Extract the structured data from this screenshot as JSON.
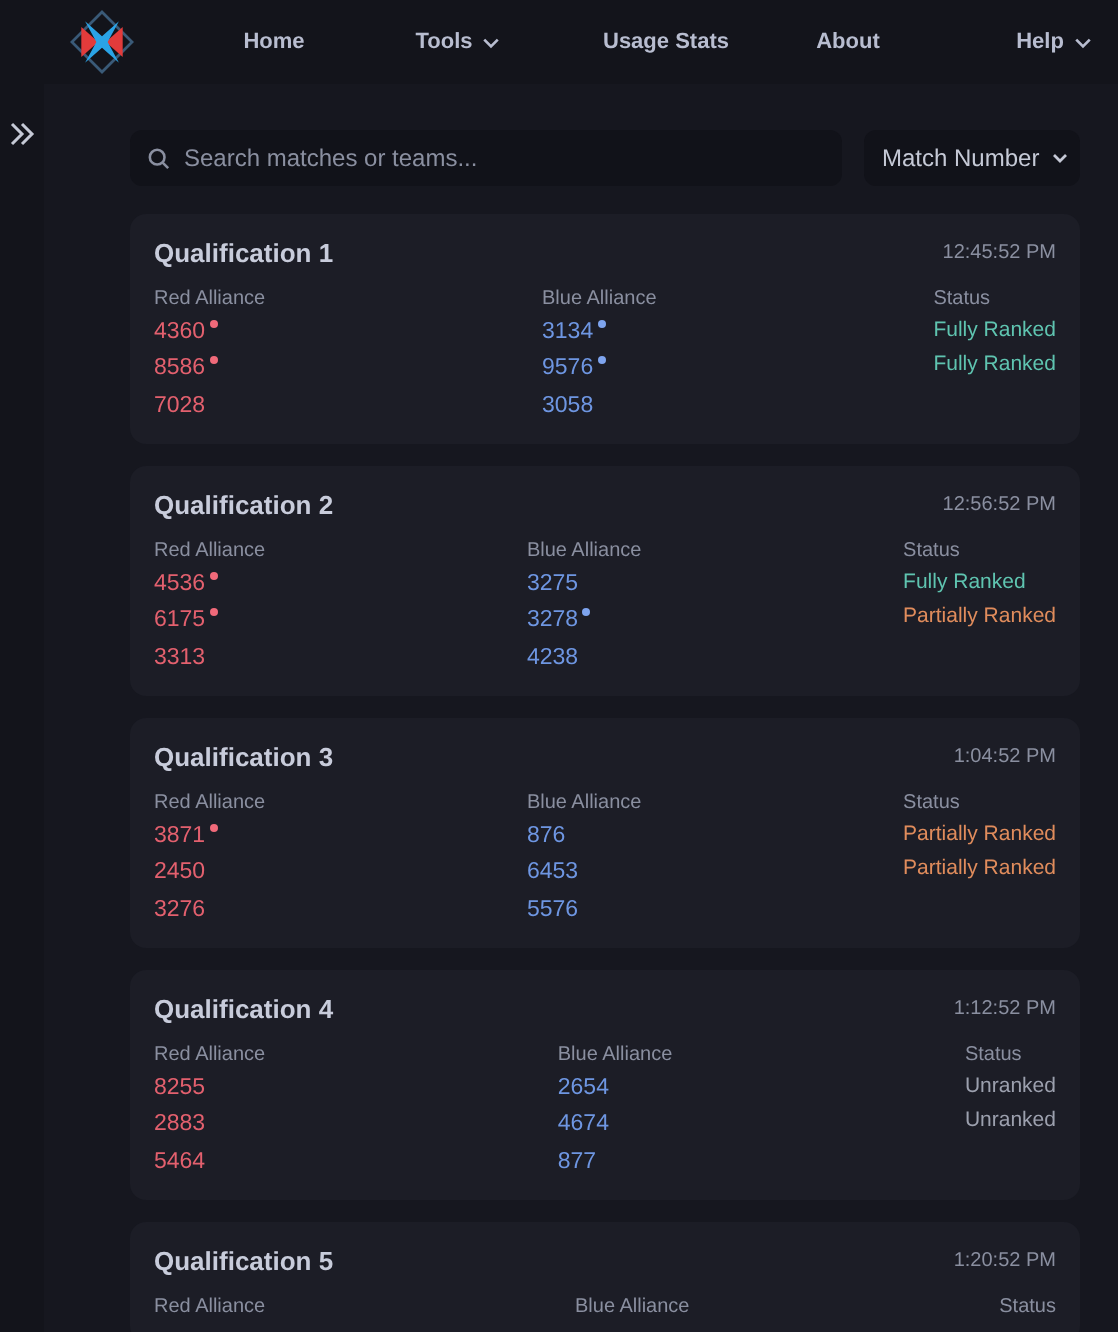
{
  "nav": {
    "items": [
      {
        "label": "Home",
        "dropdown": false
      },
      {
        "label": "Tools",
        "dropdown": true
      },
      {
        "label": "Usage Stats",
        "dropdown": false
      },
      {
        "label": "About",
        "dropdown": false
      },
      {
        "label": "Help",
        "dropdown": true
      }
    ]
  },
  "search": {
    "placeholder": "Search matches or teams..."
  },
  "sort": {
    "value": "Match Number"
  },
  "matches": [
    {
      "title": "Qualification 1",
      "time": "12:45:52 PM",
      "headers": [
        "Red Alliance",
        "Blue Alliance",
        "Status"
      ],
      "red": [
        {
          "team": "4360",
          "marked": true
        },
        {
          "team": "8586",
          "marked": true
        },
        {
          "team": "7028",
          "marked": false
        }
      ],
      "blue": [
        {
          "team": "3134",
          "marked": true
        },
        {
          "team": "9576",
          "marked": true
        },
        {
          "team": "3058",
          "marked": false
        }
      ],
      "status": [
        {
          "label": "Fully Ranked",
          "kind": "full"
        },
        {
          "label": "Fully Ranked",
          "kind": "full"
        }
      ]
    },
    {
      "title": "Qualification 2",
      "time": "12:56:52 PM",
      "headers": [
        "Red Alliance",
        "Blue Alliance",
        "Status"
      ],
      "red": [
        {
          "team": "4536",
          "marked": true
        },
        {
          "team": "6175",
          "marked": true
        },
        {
          "team": "3313",
          "marked": false
        }
      ],
      "blue": [
        {
          "team": "3275",
          "marked": false
        },
        {
          "team": "3278",
          "marked": true
        },
        {
          "team": "4238",
          "marked": false
        }
      ],
      "status": [
        {
          "label": "Fully Ranked",
          "kind": "full"
        },
        {
          "label": "Partially Ranked",
          "kind": "partial"
        }
      ]
    },
    {
      "title": "Qualification 3",
      "time": "1:04:52 PM",
      "headers": [
        "Red Alliance",
        "Blue Alliance",
        "Status"
      ],
      "red": [
        {
          "team": "3871",
          "marked": true
        },
        {
          "team": "2450",
          "marked": false
        },
        {
          "team": "3276",
          "marked": false
        }
      ],
      "blue": [
        {
          "team": "876",
          "marked": false
        },
        {
          "team": "6453",
          "marked": false
        },
        {
          "team": "5576",
          "marked": false
        }
      ],
      "status": [
        {
          "label": "Partially Ranked",
          "kind": "partial"
        },
        {
          "label": "Partially Ranked",
          "kind": "partial"
        }
      ]
    },
    {
      "title": "Qualification 4",
      "time": "1:12:52 PM",
      "headers": [
        "Red Alliance",
        "Blue Alliance",
        "Status"
      ],
      "red": [
        {
          "team": "8255",
          "marked": false
        },
        {
          "team": "2883",
          "marked": false
        },
        {
          "team": "5464",
          "marked": false
        }
      ],
      "blue": [
        {
          "team": "2654",
          "marked": false
        },
        {
          "team": "4674",
          "marked": false
        },
        {
          "team": "877",
          "marked": false
        }
      ],
      "status": [
        {
          "label": "Unranked",
          "kind": "none"
        },
        {
          "label": "Unranked",
          "kind": "none"
        }
      ]
    },
    {
      "title": "Qualification 5",
      "time": "1:20:52 PM",
      "headers": [
        "Red Alliance",
        "Blue Alliance",
        "Status"
      ]
    }
  ]
}
